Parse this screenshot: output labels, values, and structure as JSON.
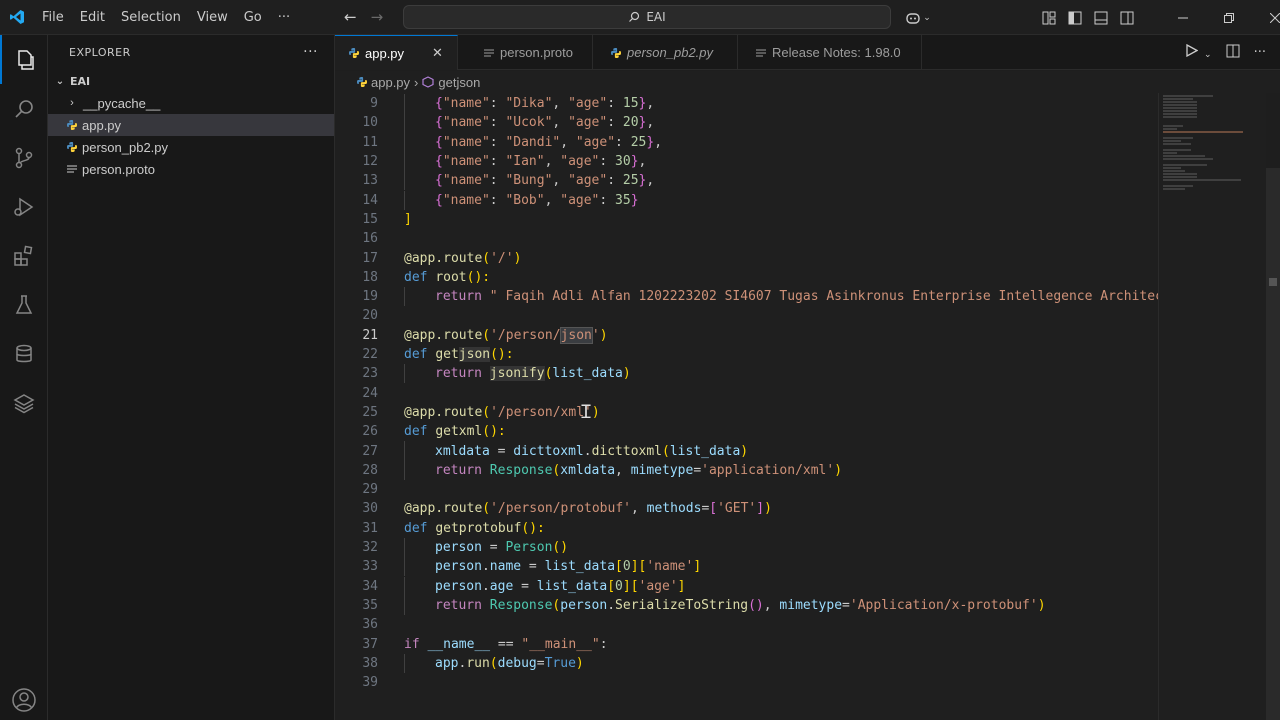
{
  "titlebar": {
    "menus": [
      "File",
      "Edit",
      "Selection",
      "View",
      "Go",
      "···"
    ],
    "search_text": "EAI",
    "window_controls": [
      "minimize",
      "restore",
      "close"
    ]
  },
  "activitybar": {
    "icons": [
      "explorer-icon",
      "search-icon",
      "source-control-icon",
      "run-debug-icon",
      "extensions-icon",
      "testing-icon",
      "database-icon",
      "layers-icon",
      "account-icon"
    ]
  },
  "sidebar": {
    "title": "EXPLORER",
    "more": "···",
    "folder": "EAI",
    "items": [
      {
        "label": "__pycache__",
        "type": "folder"
      },
      {
        "label": "app.py",
        "type": "python",
        "selected": true
      },
      {
        "label": "person_pb2.py",
        "type": "python"
      },
      {
        "label": "person.proto",
        "type": "text"
      }
    ]
  },
  "tabs": [
    {
      "label": "app.py",
      "active": true,
      "icon": "python",
      "close": "✕"
    },
    {
      "label": "person.proto",
      "icon": "lines"
    },
    {
      "label": "person_pb2.py",
      "icon": "python",
      "italic": true
    },
    {
      "label": "Release Notes: 1.98.0",
      "icon": "lines"
    }
  ],
  "breadcrumb": {
    "file": "app.py",
    "symbol": "getjson"
  },
  "editor": {
    "current_line": "21",
    "line_numbers": [
      "9",
      "10",
      "11",
      "12",
      "13",
      "14",
      "15",
      "16",
      "17",
      "18",
      "19",
      "20",
      "21",
      "22",
      "23",
      "24",
      "25",
      "26",
      "27",
      "28",
      "29",
      "30",
      "31",
      "32",
      "33",
      "34",
      "35",
      "36",
      "37",
      "38",
      "39"
    ],
    "l9": {
      "open": "{",
      "k1": "\"name\"",
      "sep1": ": ",
      "v1": "\"Dika\"",
      "sep2": ", ",
      "k2": "\"age\"",
      "sep3": ": ",
      "v2": "15",
      "close": "}",
      "tail": ","
    },
    "l10": {
      "open": "{",
      "k1": "\"name\"",
      "sep1": ": ",
      "v1": "\"Ucok\"",
      "sep2": ", ",
      "k2": "\"age\"",
      "sep3": ": ",
      "v2": "20",
      "close": "}",
      "tail": ","
    },
    "l11": {
      "open": "{",
      "k1": "\"name\"",
      "sep1": ": ",
      "v1": "\"Dandi\"",
      "sep2": ", ",
      "k2": "\"age\"",
      "sep3": ": ",
      "v2": "25",
      "close": "}",
      "tail": ","
    },
    "l12": {
      "open": "{",
      "k1": "\"name\"",
      "sep1": ": ",
      "v1": "\"Ian\"",
      "sep2": ", ",
      "k2": "\"age\"",
      "sep3": ": ",
      "v2": "30",
      "close": "}",
      "tail": ","
    },
    "l13": {
      "open": "{",
      "k1": "\"name\"",
      "sep1": ": ",
      "v1": "\"Bung\"",
      "sep2": ", ",
      "k2": "\"age\"",
      "sep3": ": ",
      "v2": "25",
      "close": "}",
      "tail": ","
    },
    "l14": {
      "open": "{",
      "k1": "\"name\"",
      "sep1": ": ",
      "v1": "\"Bob\"",
      "sep2": ", ",
      "k2": "\"age\"",
      "sep3": ": ",
      "v2": "35",
      "close": "}",
      "tail": ""
    },
    "l15": "]",
    "l17": {
      "dec": "@app.route",
      "p1": "(",
      "s": "'/'",
      "p2": ")"
    },
    "l18": {
      "kw": "def",
      "fn": "root",
      "rest": "():"
    },
    "l19": {
      "kw": "return",
      "s": "\" Faqih Adli Alfan 1202223202 SI4607 Tugas Asinkronus Enterprise Intellegence Architec"
    },
    "l21": {
      "dec": "@app.route",
      "p1": "(",
      "s1": "'/person/",
      "s2": "json",
      "s3": "'",
      "p2": ")"
    },
    "l22": {
      "kw": "def",
      "fn1": "get",
      "fn2": "json",
      "rest": "():"
    },
    "l23": {
      "kw": "return",
      "fn1": "j",
      "fn2": "sonify",
      "p1": "(",
      "v": "list_data",
      "p2": ")"
    },
    "l25": {
      "dec": "@app.route",
      "p1": "(",
      "s": "'/person/xml'",
      "p2": ")"
    },
    "l26": {
      "kw": "def",
      "fn": "getxml",
      "rest": "():"
    },
    "l27": {
      "v1": "xmldata",
      "eq": " = ",
      "v2": "dicttoxml",
      "dot": ".",
      "fn": "dicttoxml",
      "p1": "(",
      "v3": "list_data",
      "p2": ")"
    },
    "l28": {
      "kw": "return",
      "cl": "Response",
      "p1": "(",
      "v1": "xmldata",
      "sep": ", ",
      "v2": "mimetype",
      "eq": "=",
      "s": "'application/xml'",
      "p2": ")"
    },
    "l30": {
      "dec": "@app.route",
      "p1": "(",
      "s": "'/person/protobuf'",
      "sep": ", ",
      "v": "methods",
      "eq": "=",
      "b1": "[",
      "s2": "'GET'",
      "b2": "]",
      "p2": ")"
    },
    "l31": {
      "kw": "def",
      "fn": "getprotobuf",
      "rest": "():"
    },
    "l32": {
      "v1": "person",
      "eq": " = ",
      "cl": "Person",
      "p": "()"
    },
    "l33": {
      "v1": "person",
      "dot": ".",
      "v2": "name",
      "eq": " = ",
      "v3": "list_data",
      "b1": "[",
      "n": "0",
      "b2": "]",
      "b3": "[",
      "s": "'name'",
      "b4": "]"
    },
    "l34": {
      "v1": "person",
      "dot": ".",
      "v2": "age",
      "eq": " = ",
      "v3": "list_data",
      "b1": "[",
      "n": "0",
      "b2": "]",
      "b3": "[",
      "s": "'age'",
      "b4": "]"
    },
    "l35": {
      "kw": "return",
      "cl": "Response",
      "p1": "(",
      "v1": "person",
      "dot": ".",
      "fn": "SerializeToString",
      "pp": "()",
      "sep": ", ",
      "v2": "mimetype",
      "eq": "=",
      "s": "'Application/x-protobuf'",
      "p2": ")"
    },
    "l37": {
      "kw": "if",
      "v": "__name__",
      "eq": " == ",
      "s": "\"__main__\"",
      "colon": ":"
    },
    "l38": {
      "v1": "app",
      "dot": ".",
      "fn": "run",
      "p1": "(",
      "v2": "debug",
      "eq": "=",
      "k": "True",
      "p2": ")"
    }
  },
  "colors": {
    "accent": "#0078d4",
    "editor_bg": "#1f1f1f",
    "keyword": "#569cd6",
    "string": "#ce9178",
    "function": "#dcdcaa",
    "number": "#b5cea8",
    "variable": "#9cdcfe",
    "class": "#4ec9b0"
  }
}
